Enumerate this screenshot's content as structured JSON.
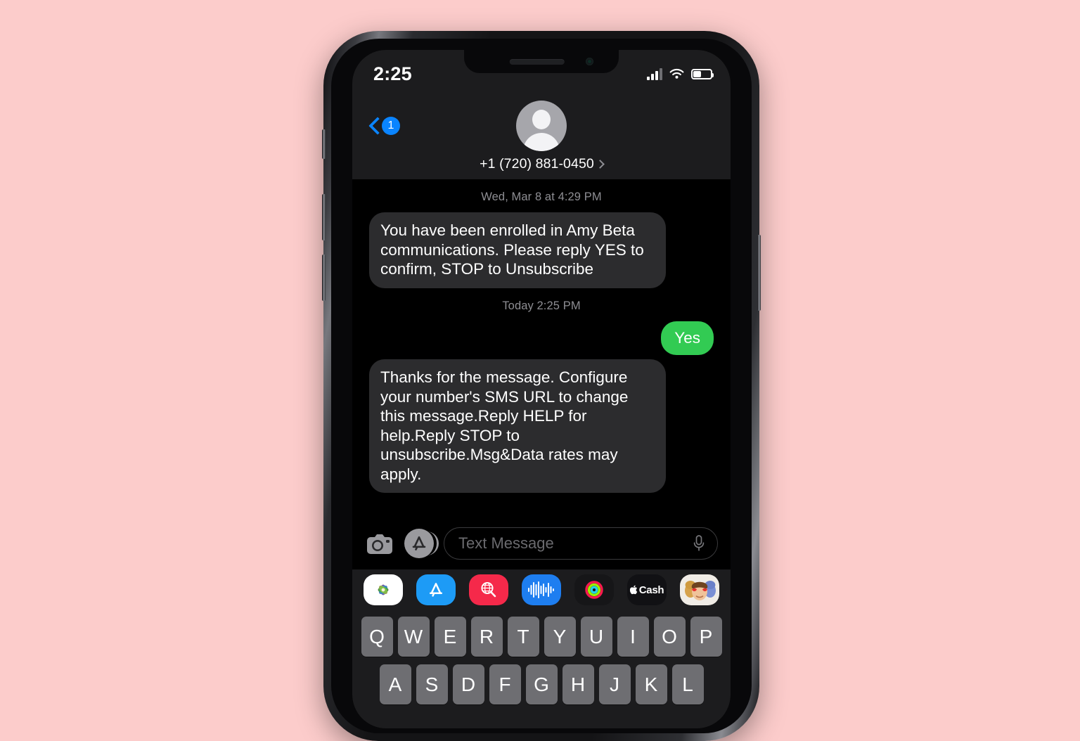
{
  "background_color": "#fccccb",
  "status_bar": {
    "time": "2:25",
    "signal_icon": "cellular-signal-icon",
    "wifi_icon": "wifi-icon",
    "battery_icon": "battery-icon",
    "battery_level_percent": 50
  },
  "conversation_header": {
    "back_label": "1",
    "back_icon": "back-chevron-icon",
    "avatar_icon": "contact-avatar-placeholder",
    "contact_name": "+1 (720) 881-0450",
    "detail_chevron_icon": "chevron-right-icon"
  },
  "chat": {
    "accent_incoming": "#2c2c2e",
    "accent_outgoing": "#32cb53",
    "items": [
      {
        "kind": "timestamp",
        "text": "Wed, Mar 8 at 4:29 PM"
      },
      {
        "kind": "message",
        "direction": "in",
        "text": "You have been enrolled in Amy Beta communications. Please reply YES to confirm, STOP to Unsubscribe"
      },
      {
        "kind": "timestamp",
        "text": "Today 2:25 PM"
      },
      {
        "kind": "message",
        "direction": "out",
        "text": "Yes"
      },
      {
        "kind": "message",
        "direction": "in",
        "text": "Thanks for the message. Configure your number's SMS URL to change this message.Reply HELP for help.Reply STOP to unsubscribe.Msg&Data rates may apply."
      }
    ]
  },
  "input_bar": {
    "camera_icon": "camera-icon",
    "appstore_icon": "app-store-icon",
    "placeholder": "Text Message",
    "mic_icon": "microphone-icon"
  },
  "app_drawer": {
    "apps": [
      {
        "name": "photos",
        "icon": "photos-icon",
        "label": ""
      },
      {
        "name": "app-store",
        "icon": "app-store-icon",
        "label": ""
      },
      {
        "name": "images",
        "icon": "images-search-icon",
        "label": ""
      },
      {
        "name": "audio-message",
        "icon": "audio-waveform-icon",
        "label": ""
      },
      {
        "name": "activity",
        "icon": "activity-rings-icon",
        "label": ""
      },
      {
        "name": "apple-cash",
        "icon": "apple-cash-icon",
        "label": "Cash"
      },
      {
        "name": "memoji",
        "icon": "memoji-stickers-icon",
        "label": ""
      }
    ]
  },
  "keyboard": {
    "rows": [
      [
        "Q",
        "W",
        "E",
        "R",
        "T",
        "Y",
        "U",
        "I",
        "O",
        "P"
      ],
      [
        "A",
        "S",
        "D",
        "F",
        "G",
        "H",
        "J",
        "K",
        "L"
      ]
    ]
  }
}
